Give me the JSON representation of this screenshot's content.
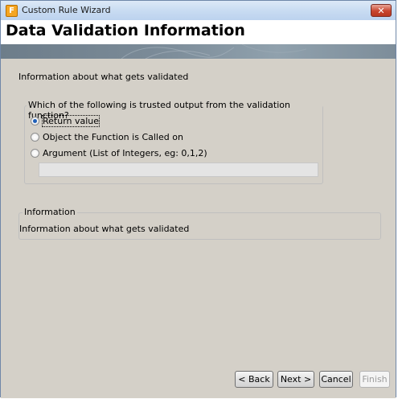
{
  "window": {
    "title": "Custom Rule Wizard",
    "app_icon_glyph": "F",
    "close_glyph": "✕"
  },
  "header": {
    "title": "Data Validation Information"
  },
  "main": {
    "description": "Information about what gets validated",
    "question_group": {
      "label": "Which of the following is trusted output from the validation function?",
      "options": [
        {
          "label": "Return value",
          "checked": true
        },
        {
          "label": "Object the Function is Called on",
          "checked": false
        },
        {
          "label": "Argument (List of Integers, eg: 0,1,2)",
          "checked": false
        }
      ],
      "argument_value": ""
    },
    "info_group": {
      "label": "Information",
      "text": "Information about what gets validated"
    }
  },
  "footer": {
    "back_label": "< Back",
    "next_label": "Next >",
    "cancel_label": "Cancel",
    "finish_label": "Finish"
  }
}
